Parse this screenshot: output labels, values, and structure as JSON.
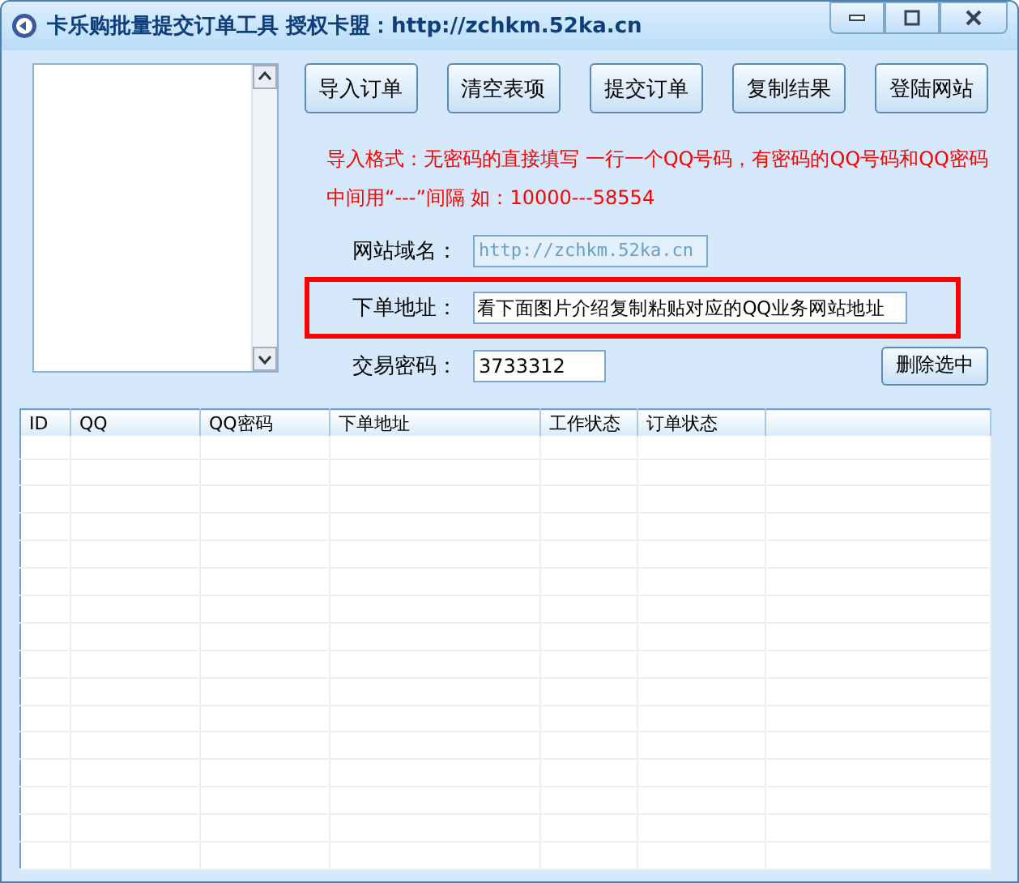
{
  "window": {
    "title": "卡乐购批量提交订单工具 授权卡盟：http://zchkm.52ka.cn"
  },
  "toolbar": [
    "导入订单",
    "清空表项",
    "提交订单",
    "复制结果",
    "登陆网站"
  ],
  "notice": [
    "导入格式：无密码的直接填写 一行一个QQ号码，有密码的QQ号码和QQ密码",
    "中间用“---”间隔 如：10000---58554"
  ],
  "fields": [
    {
      "label": "网站域名：",
      "value": "http://zchkm.52ka.cn",
      "disabled": true,
      "highlighted": false
    },
    {
      "label": "下单地址：",
      "value": "看下面图片介绍复制粘贴对应的QQ业务网站地址",
      "disabled": false,
      "highlighted": true
    },
    {
      "label": "交易密码：",
      "value": "3733312",
      "disabled": false,
      "highlighted": false
    }
  ],
  "delete_button": "删除选中",
  "table": {
    "columns": [
      "ID",
      "QQ",
      "QQ密码",
      "下单地址",
      "工作状态",
      "订单状态"
    ]
  }
}
